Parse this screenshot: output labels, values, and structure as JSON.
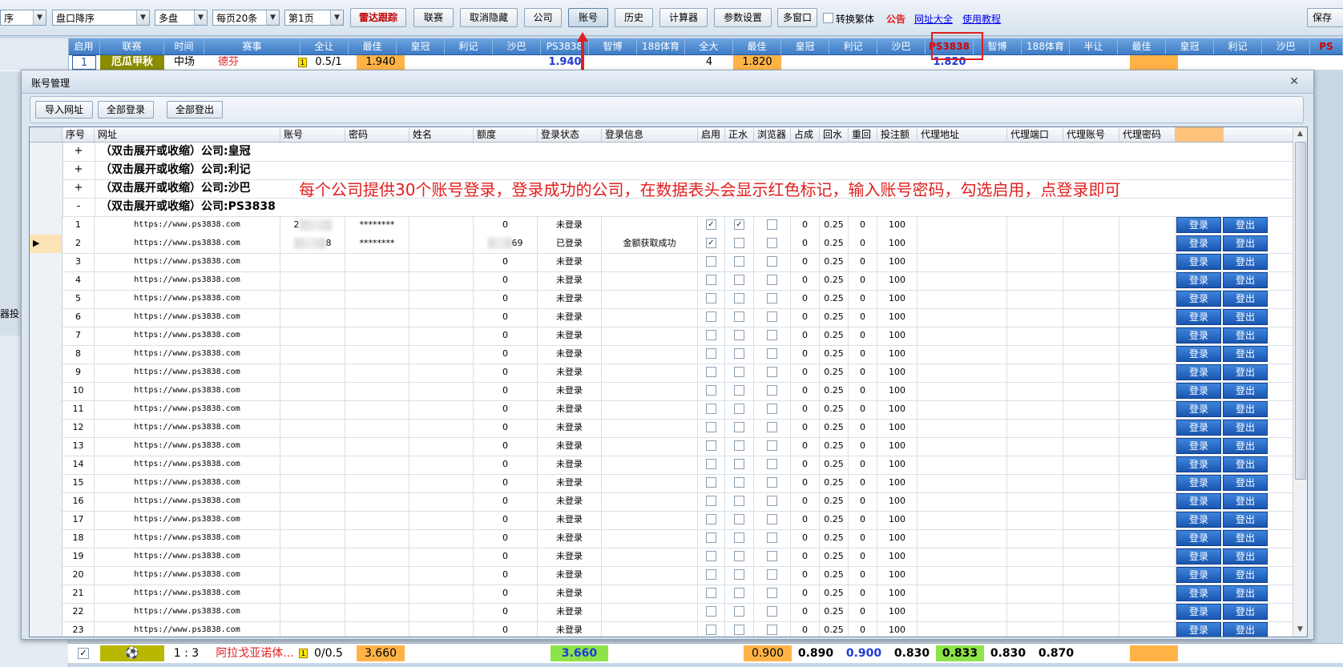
{
  "toolbar": {
    "sort_select": "盘口降序",
    "sort_prefix": "序",
    "market_select": "多盘",
    "page_size_select": "每页20条",
    "page_select": "第1页",
    "buttons": [
      "雷达跟踪",
      "联赛",
      "取消隐藏",
      "公司",
      "账号",
      "历史",
      "计算器",
      "参数设置",
      "多窗口"
    ],
    "traditional_label": "转换繁体",
    "links": [
      "公告",
      "网址大全",
      "使用教程"
    ],
    "save_label": "保存"
  },
  "main_header": {
    "columns": [
      "启用",
      "联赛",
      "时间",
      "赛事",
      "全让",
      "最佳",
      "皇冠",
      "利记",
      "沙巴",
      "PS3838",
      "智博",
      "188体育",
      "全大",
      "最佳",
      "皇冠",
      "利记",
      "沙巴",
      "PS3838",
      "智博",
      "188体育",
      "半让",
      "最佳",
      "皇冠",
      "利记",
      "沙巴",
      "PS"
    ]
  },
  "first_row": {
    "index": "1",
    "league": "厄瓜甲秋",
    "time": "中场",
    "match": "德芬",
    "badge": "1",
    "handicap": "0.5/1",
    "best": "1.940",
    "ps_value": "1.940",
    "total": "4",
    "total_best": "1.820",
    "total_ps": "1.820"
  },
  "left_panel": {
    "text": "器投"
  },
  "dialog": {
    "title": "账号管理",
    "buttons": [
      "导入网址",
      "全部登录",
      "全部登出"
    ],
    "columns": [
      "序号",
      "网址",
      "账号",
      "密码",
      "姓名",
      "额度",
      "登录状态",
      "登录信息",
      "启用",
      "正水",
      "浏览器",
      "占成",
      "回水",
      "重回",
      "投注额",
      "代理地址",
      "代理端口",
      "代理账号",
      "代理密码"
    ],
    "groups": [
      {
        "sign": "+",
        "title": "（双击展开或收缩）公司:皇冠"
      },
      {
        "sign": "+",
        "title": "（双击展开或收缩）公司:利记"
      },
      {
        "sign": "+",
        "title": "（双击展开或收缩）公司:沙巴"
      },
      {
        "sign": "-",
        "title": "（双击展开或收缩）公司:PS3838"
      }
    ],
    "annotation": "每个公司提供30个账号登录，登录成功的公司，在数据表头会显示红色标记，输入账号密码，勾选启用，点登录即可",
    "login_label": "登录",
    "logout_label": "登出",
    "rows": [
      {
        "no": "1",
        "url": "https://www.ps3838.com",
        "account": "2",
        "password": "********",
        "credit": "0",
        "status": "未登录",
        "info": "",
        "enabled": true,
        "positive": true,
        "browser": false,
        "share": "0",
        "rebate": "0.25",
        "re": "0",
        "bet": "100"
      },
      {
        "no": "2",
        "url": "https://www.ps3838.com",
        "account": "8",
        "password": "********",
        "credit": "69",
        "status": "已登录",
        "info": "金额获取成功",
        "enabled": true,
        "positive": false,
        "browser": false,
        "share": "0",
        "rebate": "0.25",
        "re": "0",
        "bet": "100"
      },
      {
        "no": "3",
        "url": "https://www.ps3838.com",
        "account": "",
        "password": "",
        "credit": "0",
        "status": "未登录",
        "info": "",
        "enabled": false,
        "positive": false,
        "browser": false,
        "share": "0",
        "rebate": "0.25",
        "re": "0",
        "bet": "100"
      },
      {
        "no": "4",
        "url": "https://www.ps3838.com",
        "account": "",
        "password": "",
        "credit": "0",
        "status": "未登录",
        "info": "",
        "enabled": false,
        "positive": false,
        "browser": false,
        "share": "0",
        "rebate": "0.25",
        "re": "0",
        "bet": "100"
      },
      {
        "no": "5",
        "url": "https://www.ps3838.com",
        "account": "",
        "password": "",
        "credit": "0",
        "status": "未登录",
        "info": "",
        "enabled": false,
        "positive": false,
        "browser": false,
        "share": "0",
        "rebate": "0.25",
        "re": "0",
        "bet": "100"
      },
      {
        "no": "6",
        "url": "https://www.ps3838.com",
        "account": "",
        "password": "",
        "credit": "0",
        "status": "未登录",
        "info": "",
        "enabled": false,
        "positive": false,
        "browser": false,
        "share": "0",
        "rebate": "0.25",
        "re": "0",
        "bet": "100"
      },
      {
        "no": "7",
        "url": "https://www.ps3838.com",
        "account": "",
        "password": "",
        "credit": "0",
        "status": "未登录",
        "info": "",
        "enabled": false,
        "positive": false,
        "browser": false,
        "share": "0",
        "rebate": "0.25",
        "re": "0",
        "bet": "100"
      },
      {
        "no": "8",
        "url": "https://www.ps3838.com",
        "account": "",
        "password": "",
        "credit": "0",
        "status": "未登录",
        "info": "",
        "enabled": false,
        "positive": false,
        "browser": false,
        "share": "0",
        "rebate": "0.25",
        "re": "0",
        "bet": "100"
      },
      {
        "no": "9",
        "url": "https://www.ps3838.com",
        "account": "",
        "password": "",
        "credit": "0",
        "status": "未登录",
        "info": "",
        "enabled": false,
        "positive": false,
        "browser": false,
        "share": "0",
        "rebate": "0.25",
        "re": "0",
        "bet": "100"
      },
      {
        "no": "10",
        "url": "https://www.ps3838.com",
        "account": "",
        "password": "",
        "credit": "0",
        "status": "未登录",
        "info": "",
        "enabled": false,
        "positive": false,
        "browser": false,
        "share": "0",
        "rebate": "0.25",
        "re": "0",
        "bet": "100"
      },
      {
        "no": "11",
        "url": "https://www.ps3838.com",
        "account": "",
        "password": "",
        "credit": "0",
        "status": "未登录",
        "info": "",
        "enabled": false,
        "positive": false,
        "browser": false,
        "share": "0",
        "rebate": "0.25",
        "re": "0",
        "bet": "100"
      },
      {
        "no": "12",
        "url": "https://www.ps3838.com",
        "account": "",
        "password": "",
        "credit": "0",
        "status": "未登录",
        "info": "",
        "enabled": false,
        "positive": false,
        "browser": false,
        "share": "0",
        "rebate": "0.25",
        "re": "0",
        "bet": "100"
      },
      {
        "no": "13",
        "url": "https://www.ps3838.com",
        "account": "",
        "password": "",
        "credit": "0",
        "status": "未登录",
        "info": "",
        "enabled": false,
        "positive": false,
        "browser": false,
        "share": "0",
        "rebate": "0.25",
        "re": "0",
        "bet": "100"
      },
      {
        "no": "14",
        "url": "https://www.ps3838.com",
        "account": "",
        "password": "",
        "credit": "0",
        "status": "未登录",
        "info": "",
        "enabled": false,
        "positive": false,
        "browser": false,
        "share": "0",
        "rebate": "0.25",
        "re": "0",
        "bet": "100"
      },
      {
        "no": "15",
        "url": "https://www.ps3838.com",
        "account": "",
        "password": "",
        "credit": "0",
        "status": "未登录",
        "info": "",
        "enabled": false,
        "positive": false,
        "browser": false,
        "share": "0",
        "rebate": "0.25",
        "re": "0",
        "bet": "100"
      },
      {
        "no": "16",
        "url": "https://www.ps3838.com",
        "account": "",
        "password": "",
        "credit": "0",
        "status": "未登录",
        "info": "",
        "enabled": false,
        "positive": false,
        "browser": false,
        "share": "0",
        "rebate": "0.25",
        "re": "0",
        "bet": "100"
      },
      {
        "no": "17",
        "url": "https://www.ps3838.com",
        "account": "",
        "password": "",
        "credit": "0",
        "status": "未登录",
        "info": "",
        "enabled": false,
        "positive": false,
        "browser": false,
        "share": "0",
        "rebate": "0.25",
        "re": "0",
        "bet": "100"
      },
      {
        "no": "18",
        "url": "https://www.ps3838.com",
        "account": "",
        "password": "",
        "credit": "0",
        "status": "未登录",
        "info": "",
        "enabled": false,
        "positive": false,
        "browser": false,
        "share": "0",
        "rebate": "0.25",
        "re": "0",
        "bet": "100"
      },
      {
        "no": "19",
        "url": "https://www.ps3838.com",
        "account": "",
        "password": "",
        "credit": "0",
        "status": "未登录",
        "info": "",
        "enabled": false,
        "positive": false,
        "browser": false,
        "share": "0",
        "rebate": "0.25",
        "re": "0",
        "bet": "100"
      },
      {
        "no": "20",
        "url": "https://www.ps3838.com",
        "account": "",
        "password": "",
        "credit": "0",
        "status": "未登录",
        "info": "",
        "enabled": false,
        "positive": false,
        "browser": false,
        "share": "0",
        "rebate": "0.25",
        "re": "0",
        "bet": "100"
      },
      {
        "no": "21",
        "url": "https://www.ps3838.com",
        "account": "",
        "password": "",
        "credit": "0",
        "status": "未登录",
        "info": "",
        "enabled": false,
        "positive": false,
        "browser": false,
        "share": "0",
        "rebate": "0.25",
        "re": "0",
        "bet": "100"
      },
      {
        "no": "22",
        "url": "https://www.ps3838.com",
        "account": "",
        "password": "",
        "credit": "0",
        "status": "未登录",
        "info": "",
        "enabled": false,
        "positive": false,
        "browser": false,
        "share": "0",
        "rebate": "0.25",
        "re": "0",
        "bet": "100"
      },
      {
        "no": "23",
        "url": "https://www.ps3838.com",
        "account": "",
        "password": "",
        "credit": "0",
        "status": "未登录",
        "info": "",
        "enabled": false,
        "positive": false,
        "browser": false,
        "share": "0",
        "rebate": "0.25",
        "re": "0",
        "bet": "100"
      }
    ]
  },
  "bottom_row": {
    "score": "1 : 3",
    "match": "阿拉戈亚诺体...",
    "badge": "1",
    "handicap": "0/0.5",
    "best": "3.660",
    "value_ps": "3.660",
    "odds": [
      "0.900",
      "0.890",
      "0.900",
      "0.830",
      "0.833",
      "0.830",
      "0.870"
    ]
  },
  "colors": {
    "accent_red": "#e02020",
    "header_blue": "#3d7cc7",
    "best_orange": "#ffb347",
    "login_blue": "#1a56b0"
  }
}
